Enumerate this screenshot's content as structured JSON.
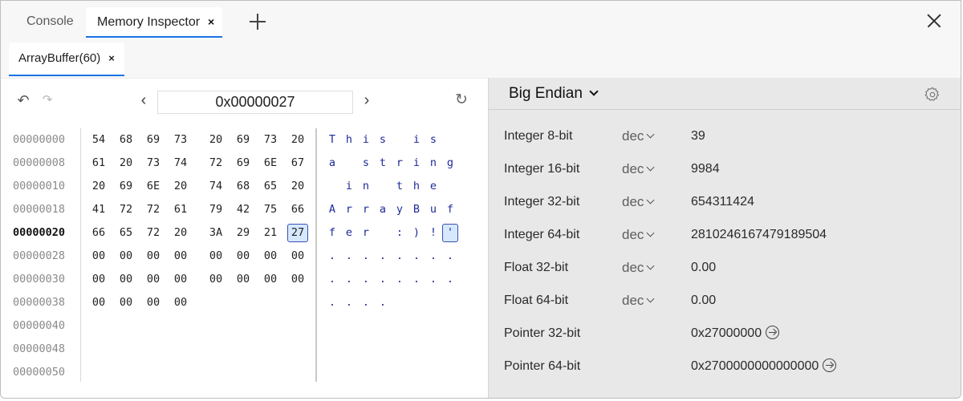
{
  "tabs": [
    {
      "label": "Console",
      "active": false
    },
    {
      "label": "Memory Inspector",
      "active": true,
      "closable": true
    }
  ],
  "icons": {
    "tab_close": "×",
    "new_tab": "plus-icon",
    "window_close": "close-icon",
    "undo": "↶",
    "redo": "↷",
    "prev": "‹",
    "next": "›",
    "refresh": "↻"
  },
  "buffer_tab": {
    "label": "ArrayBuffer(60)",
    "close": "×"
  },
  "navigator": {
    "address": "0x00000027"
  },
  "memory_rows": [
    {
      "address": "00000000",
      "bytes": [
        "54",
        "68",
        "69",
        "73",
        "20",
        "69",
        "73",
        "20"
      ],
      "ascii": [
        "T",
        "h",
        "i",
        "s",
        " ",
        "i",
        "s",
        " "
      ]
    },
    {
      "address": "00000008",
      "bytes": [
        "61",
        "20",
        "73",
        "74",
        "72",
        "69",
        "6E",
        "67"
      ],
      "ascii": [
        "a",
        " ",
        "s",
        "t",
        "r",
        "i",
        "n",
        "g"
      ]
    },
    {
      "address": "00000010",
      "bytes": [
        "20",
        "69",
        "6E",
        "20",
        "74",
        "68",
        "65",
        "20"
      ],
      "ascii": [
        " ",
        "i",
        "n",
        " ",
        "t",
        "h",
        "e",
        " "
      ]
    },
    {
      "address": "00000018",
      "bytes": [
        "41",
        "72",
        "72",
        "61",
        "79",
        "42",
        "75",
        "66"
      ],
      "ascii": [
        "A",
        "r",
        "r",
        "a",
        "y",
        "B",
        "u",
        "f"
      ]
    },
    {
      "address": "00000020",
      "bytes": [
        "66",
        "65",
        "72",
        "20",
        "3A",
        "29",
        "21",
        "27"
      ],
      "ascii": [
        "f",
        "e",
        "r",
        " ",
        ":",
        ")",
        "!",
        "'"
      ],
      "active": true,
      "selected_index": 7
    },
    {
      "address": "00000028",
      "bytes": [
        "00",
        "00",
        "00",
        "00",
        "00",
        "00",
        "00",
        "00"
      ],
      "ascii": [
        ".",
        ".",
        ".",
        ".",
        ".",
        ".",
        ".",
        "."
      ]
    },
    {
      "address": "00000030",
      "bytes": [
        "00",
        "00",
        "00",
        "00",
        "00",
        "00",
        "00",
        "00"
      ],
      "ascii": [
        ".",
        ".",
        ".",
        ".",
        ".",
        ".",
        ".",
        "."
      ]
    },
    {
      "address": "00000038",
      "bytes": [
        "00",
        "00",
        "00",
        "00"
      ],
      "ascii": [
        ".",
        ".",
        ".",
        "."
      ]
    },
    {
      "address": "00000040",
      "bytes": [],
      "ascii": []
    },
    {
      "address": "00000048",
      "bytes": [],
      "ascii": []
    },
    {
      "address": "00000050",
      "bytes": [],
      "ascii": []
    }
  ],
  "inspector": {
    "endianness": "Big Endian",
    "settings_icon": "gear-icon",
    "values": [
      {
        "label": "Integer 8-bit",
        "format": "dec",
        "value": "39"
      },
      {
        "label": "Integer 16-bit",
        "format": "dec",
        "value": "9984"
      },
      {
        "label": "Integer 32-bit",
        "format": "dec",
        "value": "654311424"
      },
      {
        "label": "Integer 64-bit",
        "format": "dec",
        "value": "2810246167479189504"
      },
      {
        "label": "Float 32-bit",
        "format": "dec",
        "value": "0.00"
      },
      {
        "label": "Float 64-bit",
        "format": "dec",
        "value": "0.00"
      },
      {
        "label": "Pointer 32-bit",
        "format": "",
        "value": "0x27000000",
        "jump": true
      },
      {
        "label": "Pointer 64-bit",
        "format": "",
        "value": "0x2700000000000000",
        "jump": true
      }
    ]
  }
}
